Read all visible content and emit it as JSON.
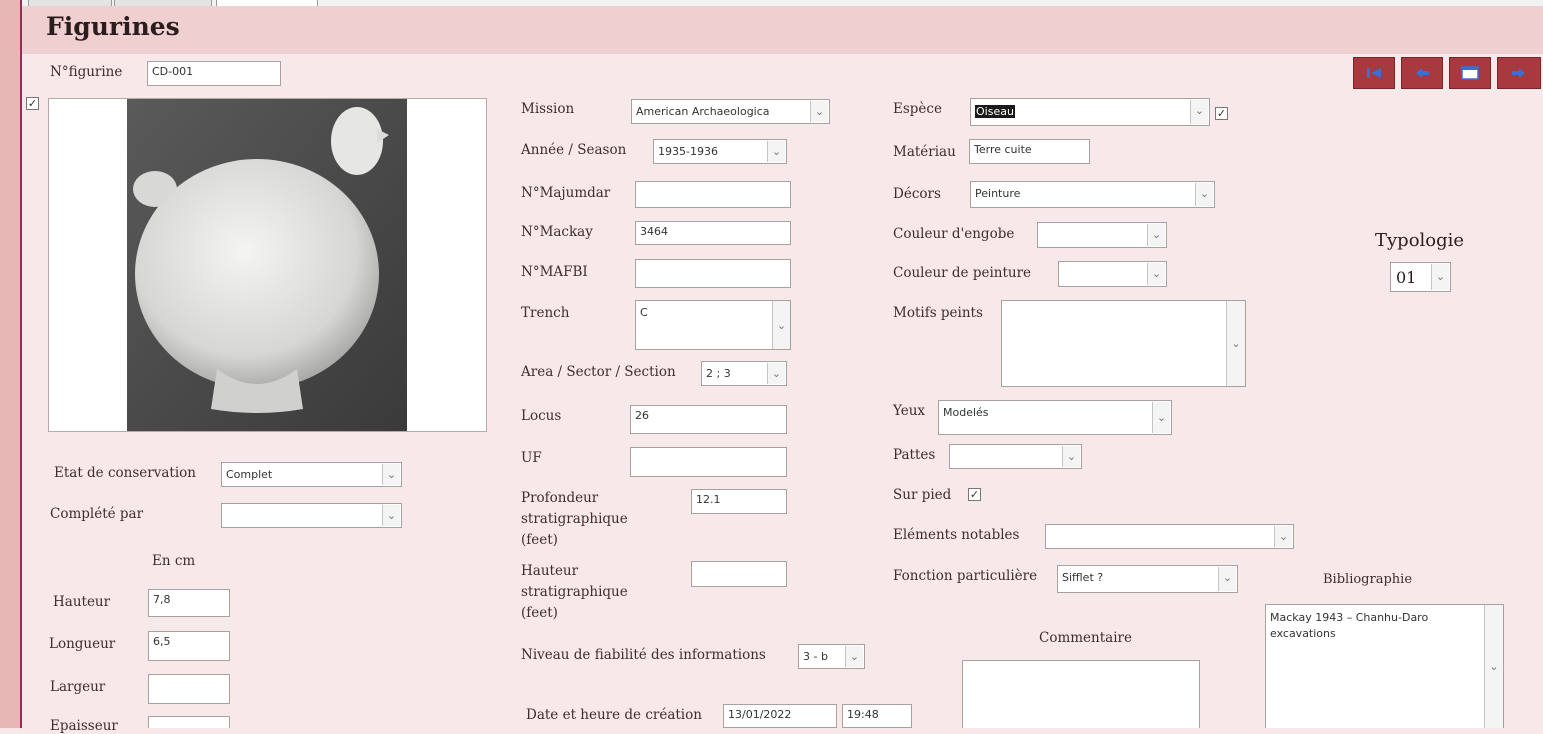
{
  "form": {
    "title": "Figurines"
  },
  "nav": {
    "first": "first-record-icon",
    "prev": "previous-record-icon",
    "new": "new-record-icon",
    "next": "next-record-icon"
  },
  "left": {
    "num_label": "N°figurine",
    "num_value": "CD-001",
    "photo_checked": true,
    "etat_label": "Etat de conservation",
    "etat_value": "Complet",
    "complete_label": "Complété par",
    "complete_value": "",
    "unit": "En cm",
    "hauteur_label": "Hauteur",
    "hauteur_value": "7,8",
    "longueur_label": "Longueur",
    "longueur_value": "6,5",
    "largeur_label": "Largeur",
    "largeur_value": "",
    "epaisseur_label": "Epaisseur",
    "epaisseur_value": ""
  },
  "mid": {
    "mission_label": "Mission",
    "mission_value": "American Archaeologica",
    "annee_label": "Année / Season",
    "annee_value": "1935-1936",
    "majumdar_label": "N°Majumdar",
    "majumdar_value": "",
    "mackay_label": "N°Mackay",
    "mackay_value": "3464",
    "mafbi_label": "N°MAFBI",
    "mafbi_value": "",
    "trench_label": "Trench",
    "trench_value": "C",
    "area_label": "Area / Sector / Section",
    "area_value": "2 ; 3",
    "locus_label": "Locus",
    "locus_value": "26",
    "uf_label": "UF",
    "uf_value": "",
    "prof_label": "Profondeur stratigraphique (feet)",
    "prof_value": "12.1",
    "haut_label": "Hauteur stratigraphique (feet)",
    "haut_value": "",
    "niveau_label": "Niveau de fiabilité des informations",
    "niveau_value": "3 - b",
    "date_label": "Date et heure de création",
    "date_value": "13/01/2022",
    "time_value": "19:48"
  },
  "right": {
    "espece_label": "Espèce",
    "espece_value": "Oiseau",
    "espece_checked": true,
    "materiau_label": "Matériau",
    "materiau_value": "Terre cuite",
    "decors_label": "Décors",
    "decors_value": "Peinture",
    "engobe_label": "Couleur d'engobe",
    "engobe_value": "",
    "peinture_label": "Couleur de peinture",
    "peinture_value": "",
    "motifs_label": "Motifs peints",
    "motifs_value": "",
    "yeux_label": "Yeux",
    "yeux_value": "Modelés",
    "pattes_label": "Pattes",
    "pattes_value": "",
    "surpied_label": "Sur pied",
    "surpied_checked": true,
    "elements_label": "Eléments notables",
    "elements_value": "",
    "fonction_label": "Fonction particulière",
    "fonction_value": "Sifflet ?",
    "commentaire_label": "Commentaire",
    "commentaire_value": ""
  },
  "far": {
    "typologie_label": "Typologie",
    "typologie_value": "01",
    "biblio_label": "Bibliographie",
    "biblio_value": "Mackay 1943 – Chanhu-Daro excavations"
  }
}
